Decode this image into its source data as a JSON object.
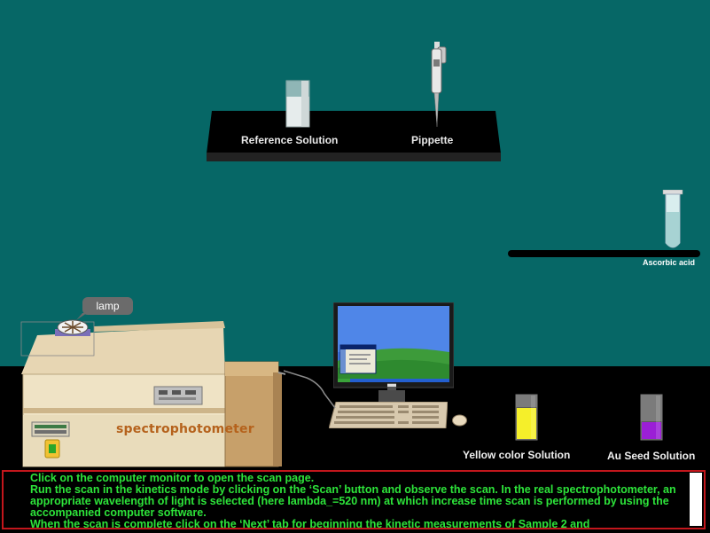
{
  "shelf": {
    "reference_label": "Reference Solution",
    "pipette_label": "Pippette"
  },
  "right_shelf": {
    "ascorbic_label": "Ascorbic acid"
  },
  "spectrophotometer": {
    "lamp_label": "lamp",
    "name": "spectrophotometer"
  },
  "vials": {
    "yellow_label": "Yellow color Solution",
    "au_label": "Au Seed Solution",
    "yellow_color": "#f5ef2a",
    "purple_color": "#9b1fd6"
  },
  "instructions": {
    "lines": [
      "Click on the computer monitor to open the scan page.",
      "Run the scan in the kinetics mode by clicking on the ‘Scan’ button and observe the scan. In the real spectrophotometer, an appropriate wavelength of light is selected (here lambda_=520 nm) at which increase time scan is performed by using the accompanied computer software.",
      "When the scan is complete click on the ‘Next’ tab for beginning the kinetic measurements of Sample 2 and"
    ]
  },
  "colors": {
    "background": "#066766",
    "floor": "#000000",
    "instruction_text": "#2de43a",
    "instruction_border": "#c3161c"
  }
}
